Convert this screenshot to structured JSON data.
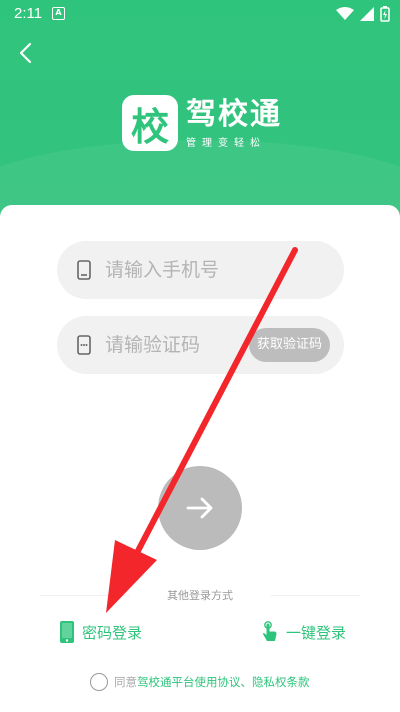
{
  "status_bar": {
    "time": "2:11",
    "notif_icon": "A"
  },
  "header": {
    "logo_char": "校",
    "app_name": "驾校通",
    "slogan": "管理变轻松"
  },
  "form": {
    "phone_placeholder": "请输入手机号",
    "code_placeholder": "请输验证码",
    "get_code_label": "获取验证码"
  },
  "other_login": {
    "title": "其他登录方式",
    "password_login": "密码登录",
    "onekey_login": "一键登录"
  },
  "agreement": {
    "prefix": "同意",
    "link_text": "驾校通平台使用协议、隐私权条款"
  },
  "colors": {
    "brand": "#2fc47c",
    "arrow": "#f2262b",
    "disabled": "#bbbbbb"
  }
}
